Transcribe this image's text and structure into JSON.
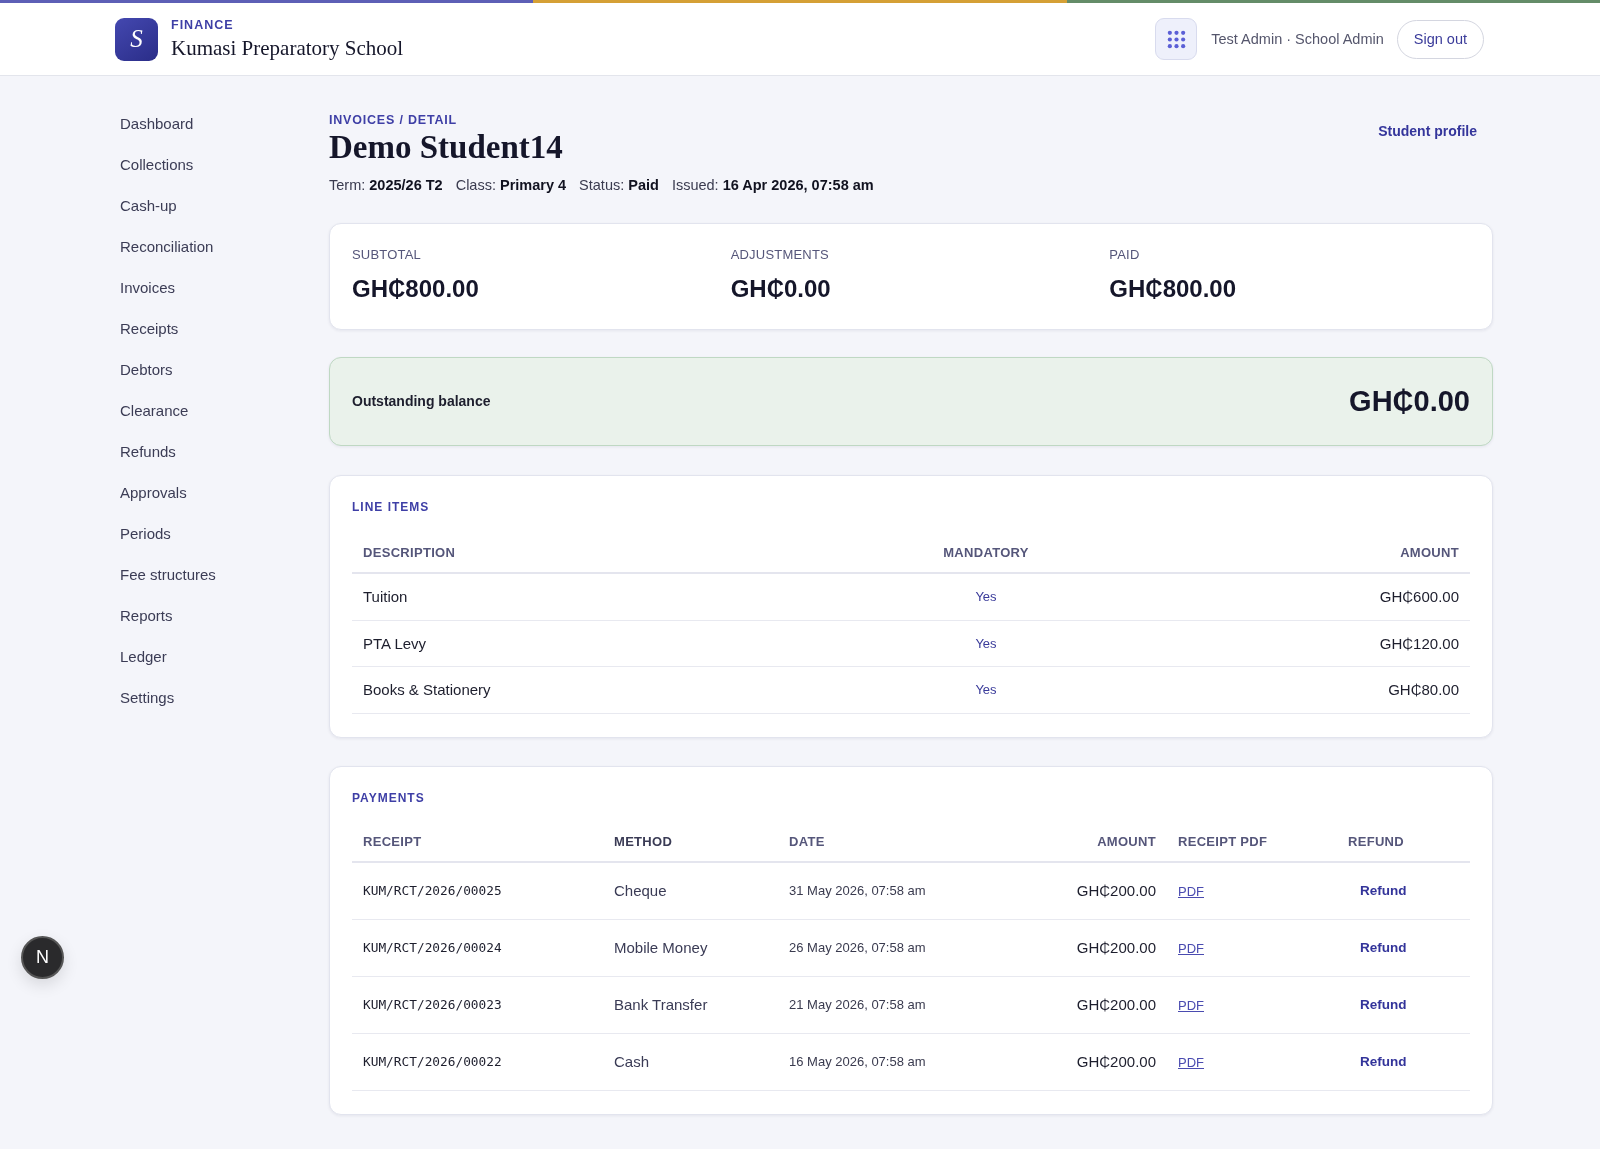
{
  "header": {
    "logo_letter": "S",
    "section": "FINANCE",
    "school_name": "Kumasi Preparatory School",
    "user": "Test Admin · School Admin",
    "sign_out": "Sign out"
  },
  "sidebar": {
    "items": [
      "Dashboard",
      "Collections",
      "Cash-up",
      "Reconciliation",
      "Invoices",
      "Receipts",
      "Debtors",
      "Clearance",
      "Refunds",
      "Approvals",
      "Periods",
      "Fee structures",
      "Reports",
      "Ledger",
      "Settings"
    ]
  },
  "breadcrumb": "INVOICES / DETAIL",
  "title": "Demo Student14",
  "meta": [
    "Term: **2025/26 T2**",
    "Class: **Primary 4**",
    "Status: **Paid**",
    "Issued: **16 Apr 2026, 07:58 am**"
  ],
  "profile_link": "Student profile",
  "summary": [
    {
      "label": "SUBTOTAL",
      "value": "GH₵800.00"
    },
    {
      "label": "ADJUSTMENTS",
      "value": "GH₵0.00"
    },
    {
      "label": "PAID",
      "value": "GH₵800.00"
    }
  ],
  "balance": {
    "label": "Outstanding balance",
    "value": "GH₵0.00"
  },
  "line_items": {
    "title": "LINE ITEMS",
    "columns": [
      "DESCRIPTION",
      "MANDATORY",
      "AMOUNT"
    ],
    "rows": [
      {
        "description": "Tuition",
        "mandatory": "Yes",
        "amount": "GH₵600.00"
      },
      {
        "description": "PTA Levy",
        "mandatory": "Yes",
        "amount": "GH₵120.00"
      },
      {
        "description": "Books & Stationery",
        "mandatory": "Yes",
        "amount": "GH₵80.00"
      }
    ]
  },
  "payments": {
    "title": "PAYMENTS",
    "columns": [
      "RECEIPT",
      "METHOD",
      "DATE",
      "AMOUNT",
      "RECEIPT PDF",
      "REFUND"
    ],
    "rows": [
      {
        "receipt": "KUM/RCT/2026/00025",
        "method": "Cheque",
        "date": "31 May 2026, 07:58 am",
        "amount": "GH₵200.00",
        "pdf": "PDF",
        "refund": "Refund"
      },
      {
        "receipt": "KUM/RCT/2026/00024",
        "method": "Mobile Money",
        "date": "26 May 2026, 07:58 am",
        "amount": "GH₵200.00",
        "pdf": "PDF",
        "refund": "Refund"
      },
      {
        "receipt": "KUM/RCT/2026/00023",
        "method": "Bank Transfer",
        "date": "21 May 2026, 07:58 am",
        "amount": "GH₵200.00",
        "pdf": "PDF",
        "refund": "Refund"
      },
      {
        "receipt": "KUM/RCT/2026/00022",
        "method": "Cash",
        "date": "16 May 2026, 07:58 am",
        "amount": "GH₵200.00",
        "pdf": "PDF",
        "refund": "Refund"
      }
    ]
  },
  "dev_indicator": {
    "label": "N"
  }
}
